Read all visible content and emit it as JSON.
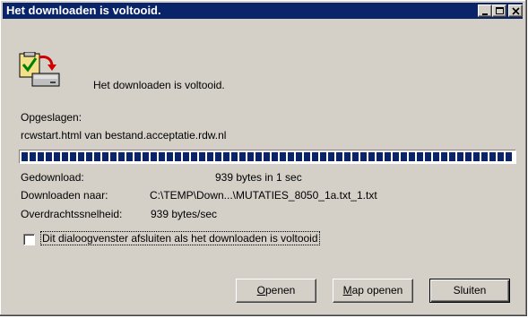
{
  "window": {
    "title": "Het downloaden is voltooid."
  },
  "header": {
    "message": "Het downloaden is voltooid.",
    "icon": "download-complete-icon"
  },
  "saved": {
    "label": "Opgeslagen:",
    "file": "rcwstart.html van bestand.acceptatie.rdw.nl"
  },
  "progress": {
    "fraction": 1.0
  },
  "details": {
    "downloaded_label": "Gedownload:",
    "downloaded_value": "939 bytes in 1 sec",
    "target_label": "Downloaden naar:",
    "target_value": "C:\\TEMP\\Down...\\MUTATIES_8050_1a.txt_1.txt",
    "rate_label": "Overdrachtssnelheid:",
    "rate_value": "939 bytes/sec"
  },
  "close_option": {
    "label": "Dit dialoogvenster afsluiten als het downloaden is voltooid",
    "checked": false
  },
  "buttons": {
    "open_first": "O",
    "open_rest": "penen",
    "open_folder_first": "M",
    "open_folder_rest": "ap openen",
    "close": "Sluiten"
  },
  "colors": {
    "titlebar": "#0a246a",
    "face": "#d4d0c8",
    "progress": "#0a246a"
  }
}
